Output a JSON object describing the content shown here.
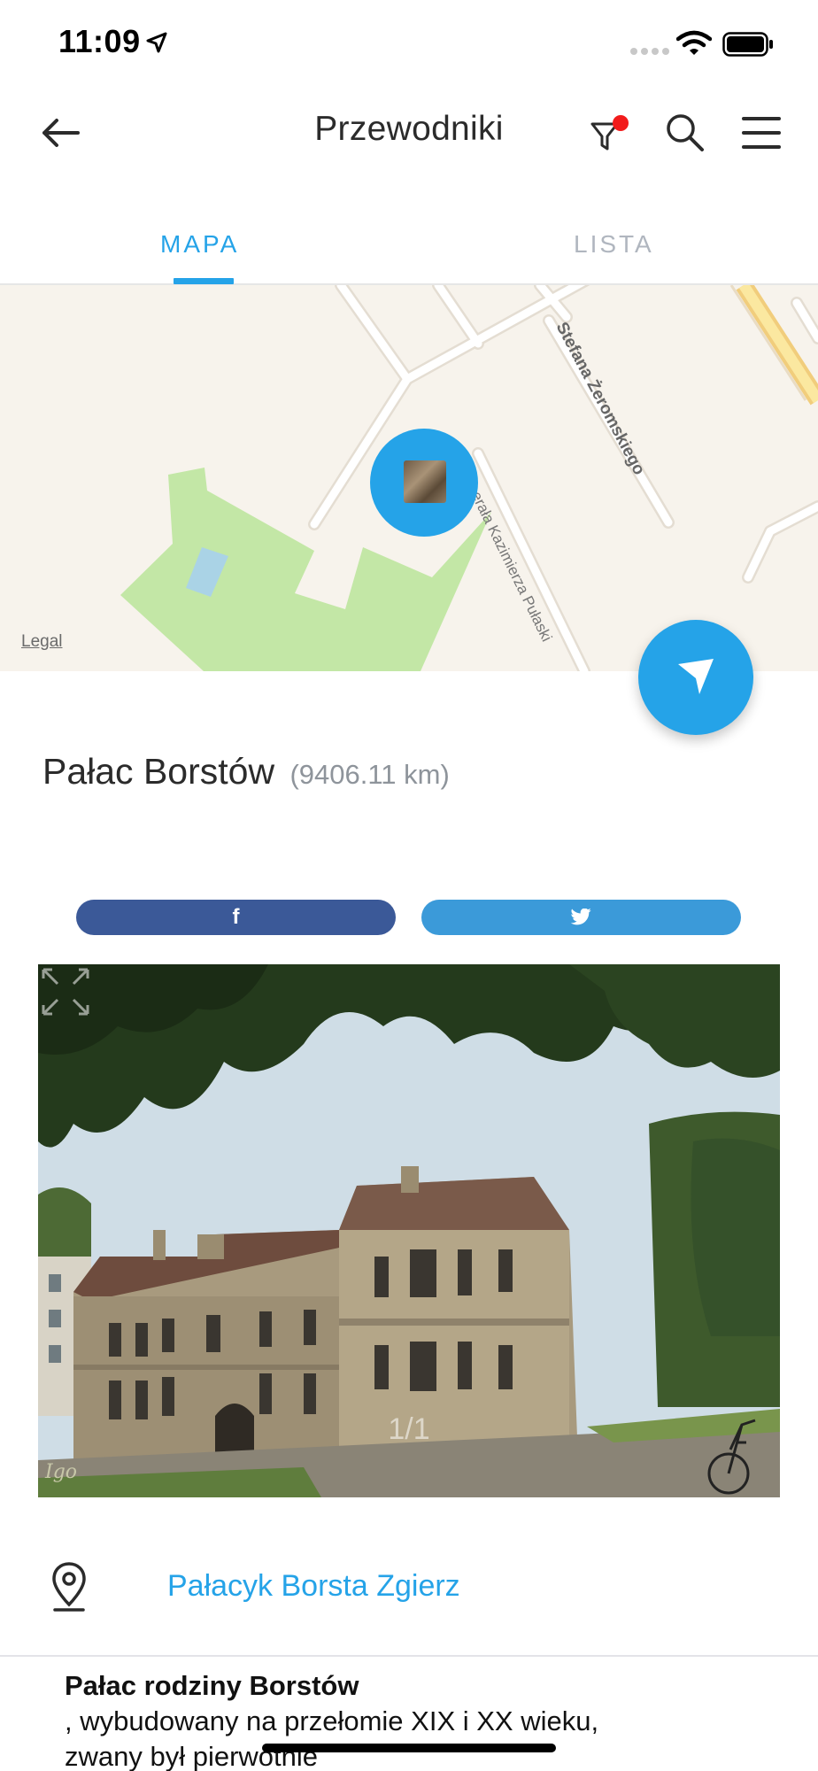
{
  "status_bar": {
    "time": "11:09",
    "icons": [
      "location-arrow-icon",
      "signal-icon",
      "wifi-icon",
      "battery-icon"
    ]
  },
  "header": {
    "title": "Przewodniki",
    "icons": [
      "back-arrow-icon",
      "filter-icon",
      "search-icon",
      "menu-icon"
    ],
    "filter_badge_color": "#f21b1b"
  },
  "tabs": [
    {
      "label": "MAPA",
      "active": true
    },
    {
      "label": "LISTA",
      "active": false
    }
  ],
  "map": {
    "legal_label": "Legal",
    "street_labels": [
      "Stefana Żeromskiego",
      "nerała Kazimierza Pułaski"
    ]
  },
  "place": {
    "name": "Pałac Borstów",
    "distance": "(9406.11 km)"
  },
  "share": {
    "facebook_icon": "f",
    "twitter_icon": "twitter-bird-icon"
  },
  "photo": {
    "counter": "1/1",
    "watermark": "Igo"
  },
  "address": {
    "icon": "location-pin-icon",
    "label": "Pałacyk Borsta Zgierz"
  },
  "description": {
    "bold": "Pałac rodziny Borstów",
    "line1": ", wybudowany na przełomie XIX i XX wieku,",
    "line2": "zwany był pierwotnie"
  },
  "colors": {
    "accent": "#25a3e8",
    "facebook": "#3b5998",
    "twitter": "#3b9ad9",
    "inactive_tab": "#b0b6bf"
  }
}
